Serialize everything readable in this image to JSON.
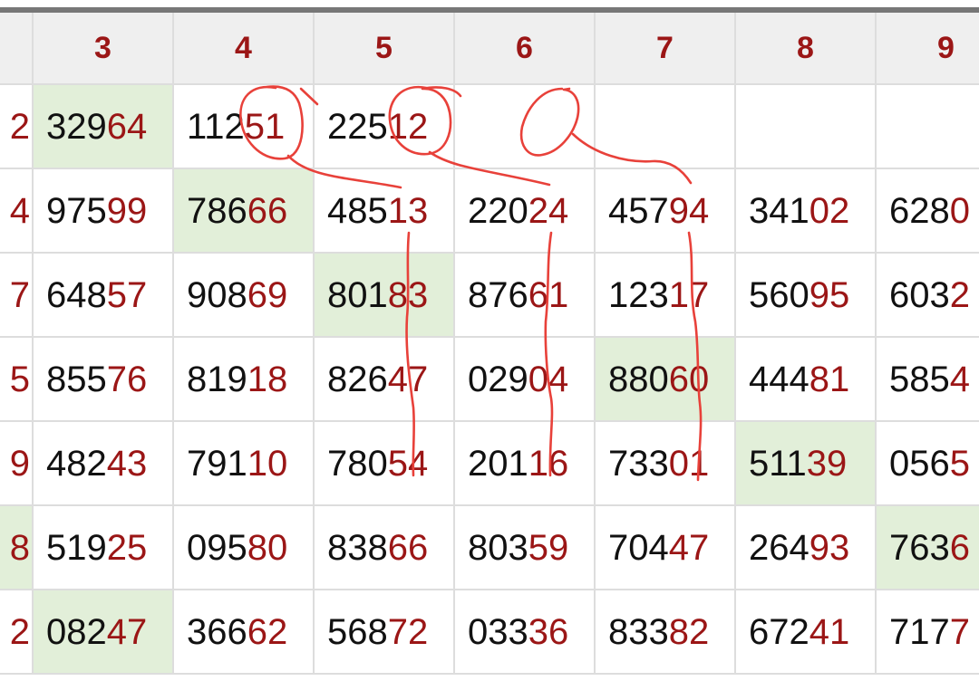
{
  "columns": [
    {
      "label": "",
      "values": [
        [
          "",
          "2"
        ],
        [
          "",
          "4"
        ],
        [
          "",
          "7"
        ],
        [
          "",
          "5"
        ],
        [
          "",
          "9"
        ],
        [
          "",
          "8"
        ],
        [
          "",
          "2"
        ]
      ],
      "highlight": [
        -1,
        -1,
        -1,
        -1,
        -1,
        5,
        -1
      ]
    },
    {
      "label": "3",
      "values": [
        [
          "329",
          "64"
        ],
        [
          "975",
          "99"
        ],
        [
          "648",
          "57"
        ],
        [
          "855",
          "76"
        ],
        [
          "482",
          "43"
        ],
        [
          "519",
          "25"
        ],
        [
          "082",
          "47"
        ]
      ]
    },
    {
      "label": "4",
      "values": [
        [
          "112",
          "51"
        ],
        [
          "786",
          "66"
        ],
        [
          "908",
          "69"
        ],
        [
          "819",
          "18"
        ],
        [
          "791",
          "10"
        ],
        [
          "095",
          "80"
        ],
        [
          "366",
          "62"
        ]
      ]
    },
    {
      "label": "5",
      "values": [
        [
          "225",
          "12"
        ],
        [
          "485",
          "13"
        ],
        [
          "801",
          "83"
        ],
        [
          "826",
          "47"
        ],
        [
          "780",
          "54"
        ],
        [
          "838",
          "66"
        ],
        [
          "568",
          "72"
        ]
      ]
    },
    {
      "label": "6",
      "values": [
        [
          "",
          ""
        ],
        [
          "220",
          "24"
        ],
        [
          "876",
          "61"
        ],
        [
          "029",
          "04"
        ],
        [
          "201",
          "16"
        ],
        [
          "803",
          "59"
        ],
        [
          "033",
          "36"
        ]
      ]
    },
    {
      "label": "7",
      "values": [
        [
          "",
          ""
        ],
        [
          "457",
          "94"
        ],
        [
          "123",
          "17"
        ],
        [
          "880",
          "60"
        ],
        [
          "733",
          "01"
        ],
        [
          "704",
          "47"
        ],
        [
          "833",
          "82"
        ]
      ]
    },
    {
      "label": "8",
      "values": [
        [
          "",
          ""
        ],
        [
          "341",
          "02"
        ],
        [
          "560",
          "95"
        ],
        [
          "444",
          "81"
        ],
        [
          "511",
          "39"
        ],
        [
          "264",
          "93"
        ],
        [
          "672",
          "41"
        ]
      ]
    },
    {
      "label": "9",
      "values": [
        [
          "",
          ""
        ],
        [
          "628",
          "0"
        ],
        [
          "603",
          "2"
        ],
        [
          "585",
          "4"
        ],
        [
          "056",
          "5"
        ],
        [
          "763",
          "6"
        ],
        [
          "717",
          "7"
        ]
      ]
    }
  ],
  "highlighted_cells": [
    [
      1,
      0
    ],
    [
      2,
      1
    ],
    [
      3,
      2
    ],
    [
      5,
      3
    ],
    [
      6,
      4
    ],
    [
      7,
      5
    ],
    [
      0,
      5
    ],
    [
      1,
      6
    ]
  ],
  "colors": {
    "header_text": "#9b1616",
    "number_prefix": "#111111",
    "number_suffix": "#9b1616",
    "highlight_bg": "#e2efd9",
    "annotation": "#e8413a"
  },
  "annotation": "hand-drawn red circles and connecting lines"
}
